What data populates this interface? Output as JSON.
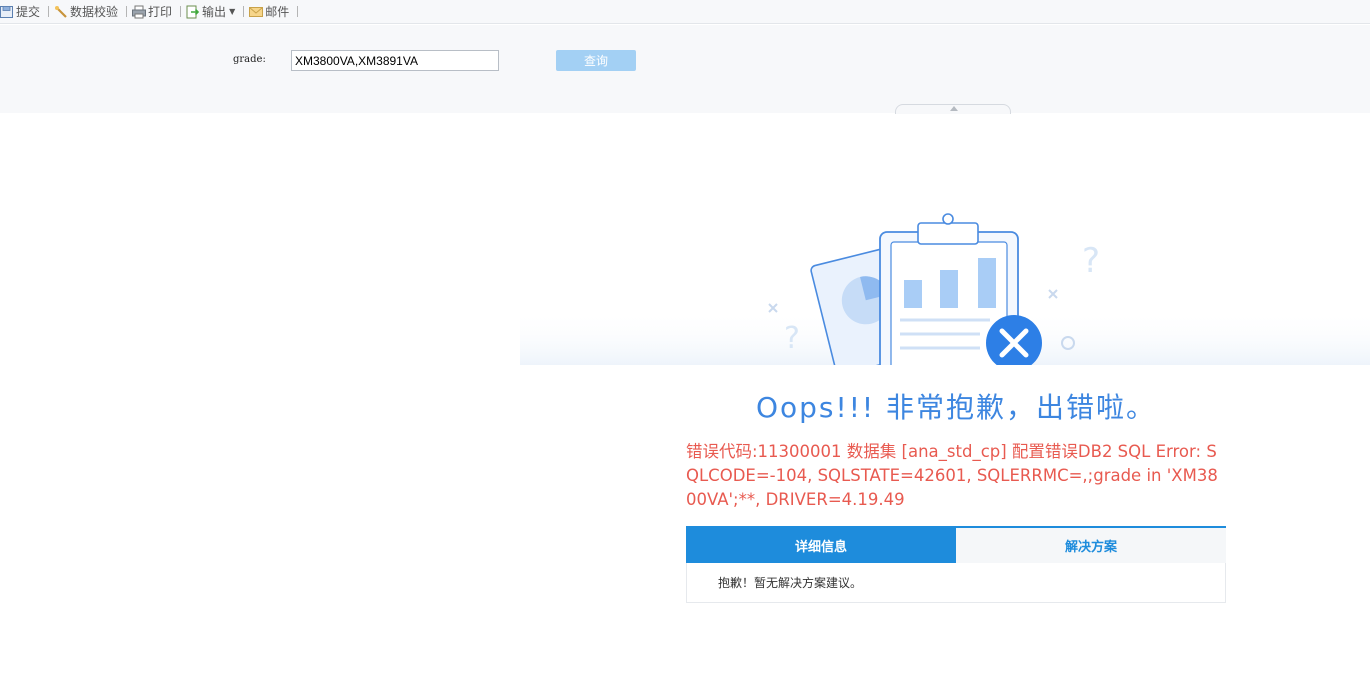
{
  "toolbar": {
    "items": [
      {
        "label": "提交",
        "icon": "submit-icon"
      },
      {
        "label": "数据校验",
        "icon": "data-check-icon"
      },
      {
        "label": "打印",
        "icon": "print-icon"
      },
      {
        "label": "输出",
        "icon": "export-icon"
      },
      {
        "label": "邮件",
        "icon": "mail-icon"
      }
    ]
  },
  "params": {
    "label": "grade:",
    "value": "XM3800VA,XM3891VA",
    "query_label": "查询"
  },
  "error": {
    "title": "Oops!!! 非常抱歉，出错啦。",
    "message": "错误代码:11300001 数据集 [ana_std_cp] 配置错误DB2 SQL Error: SQLCODE=-104, SQLSTATE=42601, SQLERRMC=,;grade in 'XM3800VA';**, DRIVER=4.19.49",
    "tabs": [
      {
        "label": "详细信息",
        "active": true
      },
      {
        "label": "解决方案",
        "active": false
      }
    ],
    "solution_text": "抱歉！暂无解决方案建议。"
  },
  "colors": {
    "accent": "#1e8cdc",
    "title": "#3d86e0",
    "error_text": "#e85a50",
    "query_button": "#a3d0f4"
  }
}
